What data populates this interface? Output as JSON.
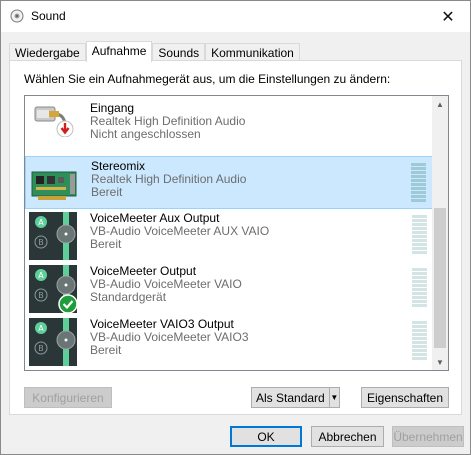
{
  "window": {
    "title": "Sound",
    "close_glyph": "✕"
  },
  "tabs": [
    {
      "label": "Wiedergabe",
      "active": false
    },
    {
      "label": "Aufnahme",
      "active": true
    },
    {
      "label": "Sounds",
      "active": false
    },
    {
      "label": "Kommunikation",
      "active": false
    }
  ],
  "panel": {
    "instruction": "Wählen Sie ein Aufnahmegerät aus, um die Einstellungen zu ändern:"
  },
  "devices": [
    {
      "name": "Eingang",
      "driver": "Realtek High Definition Audio",
      "status": "Nicht angeschlossen",
      "icon": "line-in-jack-icon",
      "selected": false
    },
    {
      "name": "Stereomix",
      "driver": "Realtek High Definition Audio",
      "status": "Bereit",
      "icon": "sound-card-icon",
      "selected": true
    },
    {
      "name": "VoiceMeeter Aux Output",
      "driver": "VB-Audio VoiceMeeter AUX VAIO",
      "status": "Bereit",
      "icon": "voicemeeter-icon",
      "selected": false
    },
    {
      "name": "VoiceMeeter Output",
      "driver": "VB-Audio VoiceMeeter VAIO",
      "status": "Standardgerät",
      "icon": "voicemeeter-icon",
      "selected": false
    },
    {
      "name": "VoiceMeeter VAIO3 Output",
      "driver": "VB-Audio VoiceMeeter VAIO3",
      "status": "Bereit",
      "icon": "voicemeeter-icon",
      "selected": false
    }
  ],
  "buttons": {
    "configure": "Konfigurieren",
    "set_default": "Als Standard",
    "properties": "Eigenschaften",
    "ok": "OK",
    "cancel": "Abbrechen",
    "apply": "Übernehmen"
  },
  "colors": {
    "selection": "#cce8ff",
    "default_button_border": "#0078d7",
    "voicemeeter_green": "#5fcf9a",
    "disabled_text": "#a0a0a0"
  }
}
